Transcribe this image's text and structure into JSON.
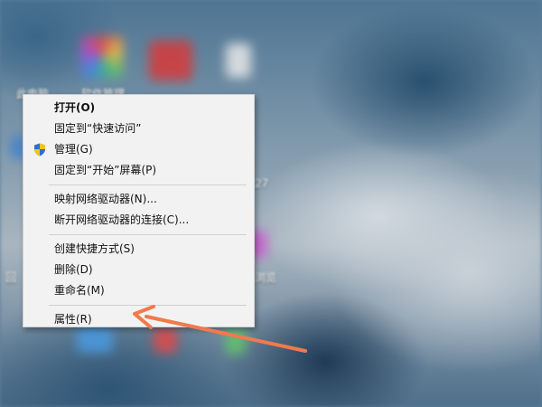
{
  "desktop": {
    "labels": [
      {
        "id": "label-1",
        "text": "此电脑"
      },
      {
        "id": "label-2",
        "text": "软件管理"
      },
      {
        "id": "label-3",
        "text": "浏览"
      },
      {
        "id": "label-4",
        "text": "27"
      },
      {
        "id": "label-5",
        "text": "回"
      }
    ]
  },
  "context_menu": {
    "items": [
      {
        "label": "打开(O)",
        "bold": true
      },
      {
        "label": "固定到“快速访问”"
      },
      {
        "label": "管理(G)",
        "icon": "shield-icon"
      },
      {
        "label": "固定到“开始”屏幕(P)"
      },
      {
        "separator": true
      },
      {
        "label": "映射网络驱动器(N)..."
      },
      {
        "label": "断开网络驱动器的连接(C)..."
      },
      {
        "separator": true
      },
      {
        "label": "创建快捷方式(S)"
      },
      {
        "label": "删除(D)"
      },
      {
        "label": "重命名(M)"
      },
      {
        "separator": true
      },
      {
        "label": "属性(R)"
      }
    ]
  },
  "annotation": {
    "color": "#f07a4c"
  },
  "colors": {
    "shield_blue": "#2e6fd1",
    "shield_yellow": "#f3c21b"
  }
}
